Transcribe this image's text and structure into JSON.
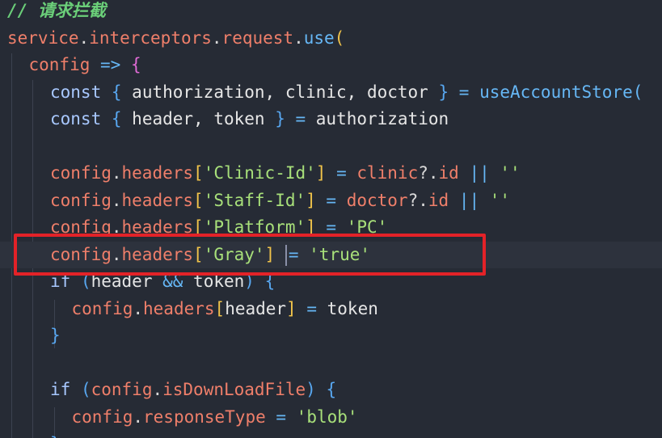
{
  "editor": {
    "lines": [
      {
        "indent": 0,
        "tokens": [
          {
            "t": "// 请求拦截",
            "c": "comment"
          }
        ]
      },
      {
        "indent": 0,
        "tokens": [
          {
            "t": "service",
            "c": "var"
          },
          {
            "t": ".",
            "c": "punc"
          },
          {
            "t": "interceptors",
            "c": "var"
          },
          {
            "t": ".",
            "c": "punc"
          },
          {
            "t": "request",
            "c": "var"
          },
          {
            "t": ".",
            "c": "punc"
          },
          {
            "t": "use",
            "c": "fn"
          },
          {
            "t": "(",
            "c": "brace-gold"
          }
        ]
      },
      {
        "indent": 1,
        "tokens": [
          {
            "t": "config",
            "c": "var"
          },
          {
            "t": " => ",
            "c": "op"
          },
          {
            "t": "{",
            "c": "brace-pink"
          }
        ]
      },
      {
        "indent": 2,
        "tokens": [
          {
            "t": "const",
            "c": "kw"
          },
          {
            "t": " ",
            "c": "plain"
          },
          {
            "t": "{",
            "c": "brace-blue"
          },
          {
            "t": " authorization, clinic, doctor ",
            "c": "plain"
          },
          {
            "t": "}",
            "c": "brace-blue"
          },
          {
            "t": " = ",
            "c": "op"
          },
          {
            "t": "useAccountStore(",
            "c": "fn"
          }
        ]
      },
      {
        "indent": 2,
        "tokens": [
          {
            "t": "const",
            "c": "kw"
          },
          {
            "t": " ",
            "c": "plain"
          },
          {
            "t": "{",
            "c": "brace-blue"
          },
          {
            "t": " header, token ",
            "c": "plain"
          },
          {
            "t": "}",
            "c": "brace-blue"
          },
          {
            "t": " = ",
            "c": "op"
          },
          {
            "t": "authorization",
            "c": "plain"
          }
        ]
      },
      {
        "indent": 2,
        "tokens": []
      },
      {
        "indent": 2,
        "tokens": [
          {
            "t": "config",
            "c": "var"
          },
          {
            "t": ".",
            "c": "punc"
          },
          {
            "t": "headers",
            "c": "var"
          },
          {
            "t": "[",
            "c": "brace-gold"
          },
          {
            "t": "'Clinic-Id'",
            "c": "str"
          },
          {
            "t": "]",
            "c": "brace-gold"
          },
          {
            "t": " = ",
            "c": "op"
          },
          {
            "t": "clinic",
            "c": "var"
          },
          {
            "t": "?.",
            "c": "punc"
          },
          {
            "t": "id",
            "c": "var"
          },
          {
            "t": " || ",
            "c": "op"
          },
          {
            "t": "''",
            "c": "str"
          }
        ]
      },
      {
        "indent": 2,
        "tokens": [
          {
            "t": "config",
            "c": "var"
          },
          {
            "t": ".",
            "c": "punc"
          },
          {
            "t": "headers",
            "c": "var"
          },
          {
            "t": "[",
            "c": "brace-gold"
          },
          {
            "t": "'Staff-Id'",
            "c": "str"
          },
          {
            "t": "]",
            "c": "brace-gold"
          },
          {
            "t": " = ",
            "c": "op"
          },
          {
            "t": "doctor",
            "c": "var"
          },
          {
            "t": "?.",
            "c": "punc"
          },
          {
            "t": "id",
            "c": "var"
          },
          {
            "t": " || ",
            "c": "op"
          },
          {
            "t": "''",
            "c": "str"
          }
        ]
      },
      {
        "indent": 2,
        "tokens": [
          {
            "t": "config",
            "c": "var"
          },
          {
            "t": ".",
            "c": "punc"
          },
          {
            "t": "headers",
            "c": "var"
          },
          {
            "t": "[",
            "c": "brace-gold"
          },
          {
            "t": "'Platform'",
            "c": "str"
          },
          {
            "t": "]",
            "c": "brace-gold"
          },
          {
            "t": " = ",
            "c": "op"
          },
          {
            "t": "'PC'",
            "c": "str"
          }
        ]
      },
      {
        "indent": 2,
        "current": true,
        "tokens": [
          {
            "t": "config",
            "c": "var"
          },
          {
            "t": ".",
            "c": "punc"
          },
          {
            "t": "headers",
            "c": "var"
          },
          {
            "t": "[",
            "c": "brace-gold"
          },
          {
            "t": "'Gray'",
            "c": "str"
          },
          {
            "t": "]",
            "c": "brace-gold"
          },
          {
            "t": " ",
            "c": "plain"
          },
          {
            "t": "",
            "c": "caret"
          },
          {
            "t": "= ",
            "c": "op"
          },
          {
            "t": "'true'",
            "c": "str"
          }
        ]
      },
      {
        "indent": 2,
        "tokens": [
          {
            "t": "if",
            "c": "kw"
          },
          {
            "t": " ",
            "c": "plain"
          },
          {
            "t": "(",
            "c": "brace-blue"
          },
          {
            "t": "header",
            "c": "plain"
          },
          {
            "t": " && ",
            "c": "op"
          },
          {
            "t": "token",
            "c": "plain"
          },
          {
            "t": ")",
            "c": "brace-blue"
          },
          {
            "t": " ",
            "c": "plain"
          },
          {
            "t": "{",
            "c": "brace-blue"
          }
        ]
      },
      {
        "indent": 3,
        "tokens": [
          {
            "t": "config",
            "c": "var"
          },
          {
            "t": ".",
            "c": "punc"
          },
          {
            "t": "headers",
            "c": "var"
          },
          {
            "t": "[",
            "c": "brace-gold"
          },
          {
            "t": "header",
            "c": "plain"
          },
          {
            "t": "]",
            "c": "brace-gold"
          },
          {
            "t": " = ",
            "c": "op"
          },
          {
            "t": "token",
            "c": "plain"
          }
        ]
      },
      {
        "indent": 2,
        "tokens": [
          {
            "t": "}",
            "c": "brace-blue"
          }
        ]
      },
      {
        "indent": 2,
        "tokens": []
      },
      {
        "indent": 2,
        "tokens": [
          {
            "t": "if",
            "c": "kw"
          },
          {
            "t": " ",
            "c": "plain"
          },
          {
            "t": "(",
            "c": "brace-blue"
          },
          {
            "t": "config",
            "c": "var"
          },
          {
            "t": ".",
            "c": "punc"
          },
          {
            "t": "isDownLoadFile",
            "c": "var"
          },
          {
            "t": ")",
            "c": "brace-blue"
          },
          {
            "t": " ",
            "c": "plain"
          },
          {
            "t": "{",
            "c": "brace-blue"
          }
        ]
      },
      {
        "indent": 3,
        "tokens": [
          {
            "t": "config",
            "c": "var"
          },
          {
            "t": ".",
            "c": "punc"
          },
          {
            "t": "responseType",
            "c": "var"
          },
          {
            "t": " = ",
            "c": "op"
          },
          {
            "t": "'blob'",
            "c": "str"
          }
        ]
      },
      {
        "indent": 2,
        "tokens": [
          {
            "t": "}",
            "c": "brace-blue"
          }
        ]
      }
    ]
  },
  "colors": {
    "background": "#262b35",
    "current_line": "#2d323d",
    "annotation_box": "#e32228"
  }
}
